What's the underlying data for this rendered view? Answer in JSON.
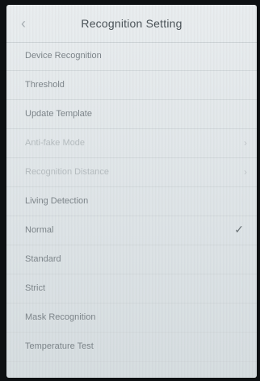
{
  "header": {
    "title": "Recognition Setting",
    "back_icon": "chevron-left-icon"
  },
  "items": [
    {
      "label": "Device Recognition",
      "type": "nav"
    },
    {
      "label": "Threshold",
      "type": "nav"
    },
    {
      "label": "Update Template",
      "type": "nav"
    },
    {
      "label": "Anti-fake Mode",
      "type": "nav",
      "disabled": true
    },
    {
      "label": "Recognition Distance",
      "type": "nav",
      "disabled": true
    },
    {
      "label": "Living Detection",
      "type": "toggle",
      "on": true
    },
    {
      "label": "Normal",
      "type": "option",
      "selected": true
    },
    {
      "label": "Standard",
      "type": "option",
      "selected": false
    },
    {
      "label": "Strict",
      "type": "option",
      "selected": false
    },
    {
      "label": "Mask Recognition",
      "type": "toggle",
      "on": true
    },
    {
      "label": "Temperature Test",
      "type": "toggle",
      "on": true
    }
  ],
  "colors": {
    "toggle_on": "#2f6b3c",
    "background": "#e4e9ec"
  }
}
